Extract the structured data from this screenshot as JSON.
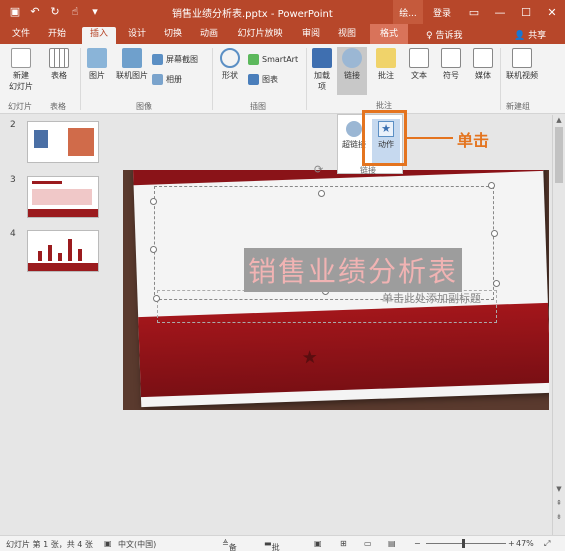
{
  "titlebar": {
    "document_title": "销售业绩分析表.pptx - PowerPoint",
    "context_tab_short": "绘...",
    "login": "登录",
    "qat_icons": [
      "save-icon",
      "undo-icon",
      "redo-icon",
      "touch-mode-icon",
      "customize-icon"
    ]
  },
  "tabs": {
    "items": [
      "文件",
      "开始",
      "插入",
      "设计",
      "切换",
      "动画",
      "幻灯片放映",
      "审阅",
      "视图",
      "格式"
    ],
    "active": "插入",
    "tell_me": "♀ 告诉我",
    "share": "共享"
  },
  "ribbon": {
    "new_slide": "新建\n幻灯片",
    "table": "表格",
    "picture": "图片",
    "online_picture": "联机图片",
    "screenshot": "屏幕截图",
    "album": "相册",
    "shapes": "形状",
    "smartart": "SmartArt",
    "chart": "图表",
    "addins": "加载\n项",
    "links": "链接",
    "comment": "批注",
    "text": "文本",
    "symbol": "符号",
    "media": "媒体",
    "online_video": "联机视频",
    "groups": {
      "slides": "幻灯片",
      "tables": "表格",
      "images": "图像",
      "illustrations": "插图",
      "comments": "批注",
      "new_group": "新建组"
    }
  },
  "dropdown": {
    "hyperlink": "超链接",
    "action": "动作",
    "footer_label": "链接"
  },
  "callout": "单击",
  "thumbnails": [
    {
      "number": "2"
    },
    {
      "number": "3"
    },
    {
      "number": "4"
    }
  ],
  "slide": {
    "title": "销售业绩分析表",
    "subtitle": "单击此处添加副标题"
  },
  "status": {
    "slide_info": "幻灯片 第 1 张，共 4 张",
    "language": "中文(中国)",
    "notes": "备注",
    "comments": "批注",
    "zoom": "47%"
  },
  "colors": {
    "accent": "#b7472a",
    "highlight": "#e4741f",
    "slide_red": "#9b1b1e"
  }
}
